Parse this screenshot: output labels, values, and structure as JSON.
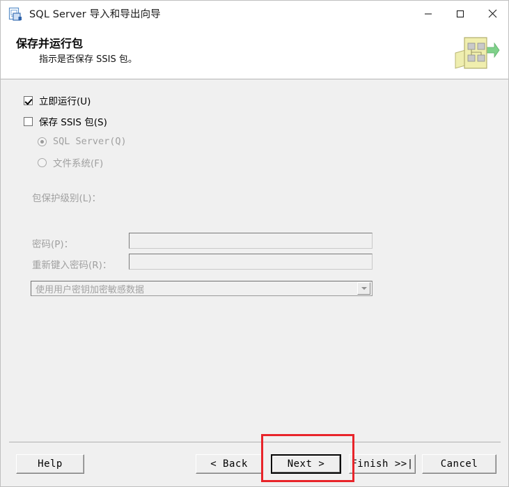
{
  "window": {
    "title": "SQL Server 导入和导出向导",
    "title_icon": "wizard-document-icon",
    "controls": {
      "minimize": "minimize-icon",
      "maximize": "maximize-icon",
      "close": "close-icon"
    }
  },
  "header": {
    "title": "保存并运行包",
    "subtitle": "指示是否保存 SSIS 包。",
    "logo": "ssis-package-icon"
  },
  "form": {
    "run_immediately": {
      "label": "立即运行(U)",
      "checked": true,
      "enabled": true
    },
    "save_ssis_package": {
      "label": "保存 SSIS 包(S)",
      "checked": false,
      "enabled": true
    },
    "destination_options": [
      {
        "label": "SQL Server(Q)",
        "selected": true,
        "enabled": false
      },
      {
        "label": "文件系统(F)",
        "selected": false,
        "enabled": false
      }
    ],
    "protection_level": {
      "label": "包保护级别(L)：",
      "value": "使用用户密钥加密敏感数据",
      "enabled": false,
      "arrow_icon": "chevron-down-icon"
    },
    "password": {
      "label": "密码(P)：",
      "value": "",
      "enabled": false
    },
    "password_confirm": {
      "label": "重新键入密码(R)：",
      "value": "",
      "enabled": false
    }
  },
  "footer": {
    "help": "Help",
    "back": "< Back",
    "next": "Next >",
    "finish": "Finish >>|",
    "cancel": "Cancel"
  },
  "annotation": {
    "target": "next-button",
    "color": "#e8242a"
  }
}
